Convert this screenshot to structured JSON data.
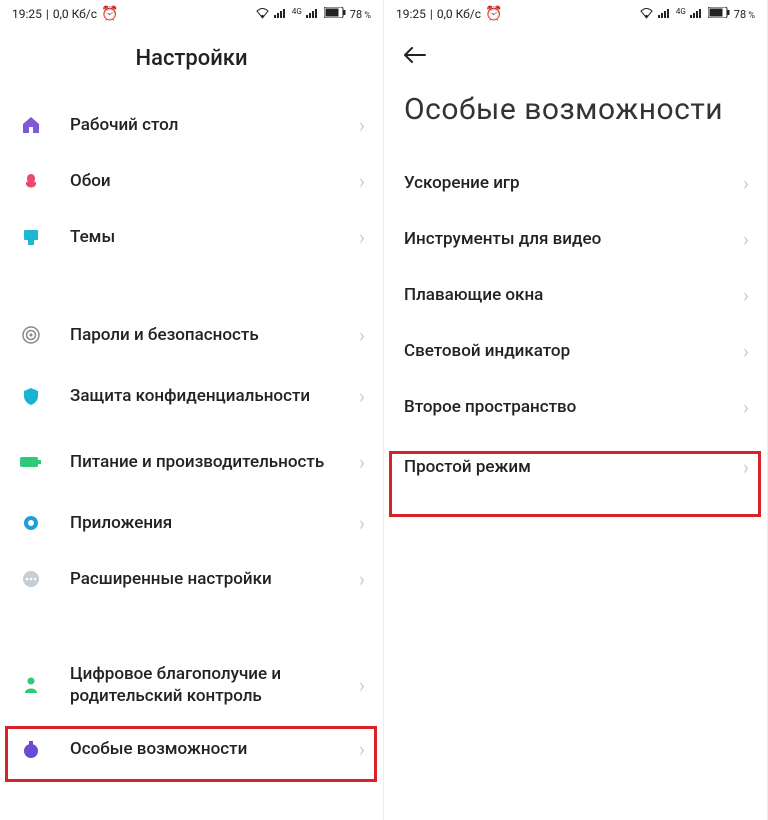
{
  "status": {
    "time": "19:25",
    "speed": "0,0 Кб/с",
    "alarm": "⏰",
    "battery_pct": "78",
    "network_label": "4G"
  },
  "left": {
    "title": "Настройки",
    "items": [
      {
        "label": "Рабочий стол",
        "icon": "home-icon"
      },
      {
        "label": "Обои",
        "icon": "wallpaper-icon"
      },
      {
        "label": "Темы",
        "icon": "themes-icon"
      },
      {
        "label": "Пароли и безопасность",
        "icon": "security-icon"
      },
      {
        "label": "Защита конфиденциальности",
        "icon": "privacy-icon"
      },
      {
        "label": "Питание и производительность",
        "icon": "battery-perf-icon"
      },
      {
        "label": "Приложения",
        "icon": "apps-icon"
      },
      {
        "label": "Расширенные настройки",
        "icon": "advanced-icon"
      },
      {
        "label": "Цифровое благополучие и родительский контроль",
        "icon": "wellbeing-icon"
      },
      {
        "label": "Особые возможности",
        "icon": "features-icon"
      }
    ]
  },
  "right": {
    "title": "Особые возможности",
    "items": [
      {
        "label": "Ускорение игр"
      },
      {
        "label": "Инструменты для видео"
      },
      {
        "label": "Плавающие окна"
      },
      {
        "label": "Световой индикатор"
      },
      {
        "label": "Второе пространство"
      },
      {
        "label": "Простой режим"
      }
    ]
  }
}
